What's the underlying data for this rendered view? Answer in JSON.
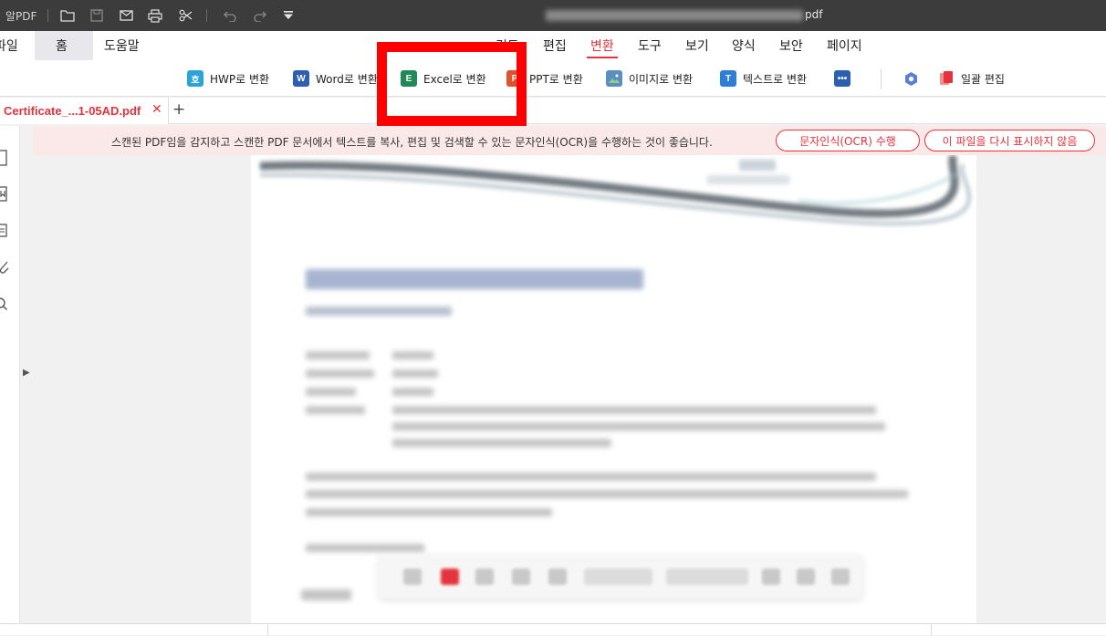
{
  "titlebar": {
    "app_name": "알PDF",
    "file_title_suffix": "pdf"
  },
  "menu": {
    "items": [
      "파일",
      "홈",
      "도움말",
      "검토",
      "편집",
      "변환",
      "도구",
      "보기",
      "양식",
      "보안",
      "페이지"
    ],
    "active": "변환"
  },
  "ribbon": {
    "hwp": "HWP로 변환",
    "word": "Word로 변환",
    "excel": "Excel로 변환",
    "ppt": "PPT로 변환",
    "image": "이미지로 변환",
    "text": "텍스트로 변환",
    "batch": "일괄 편집",
    "more_icon": "more-icon",
    "settings_icon": "gear-icon"
  },
  "document_tab": {
    "name": "Certificate_...1-05AD.pdf",
    "close": "✕",
    "add": "+"
  },
  "ocr_banner": {
    "message": "스캔된 PDF임을 감지하고 스캔한 PDF 문서에서 텍스트를 복사, 편집 및 검색할 수 있는 문자인식(OCR)을 수행하는 것이 좋습니다.",
    "ocr_button": "문자인식(OCR) 수행",
    "dismiss_button": "이 파일을 다시 표시하지 않음"
  },
  "colors": {
    "accent": "#e5333d",
    "titlebar": "#3c3c3c",
    "highlight": "#ff0000",
    "banner": "#fbe9e9"
  }
}
